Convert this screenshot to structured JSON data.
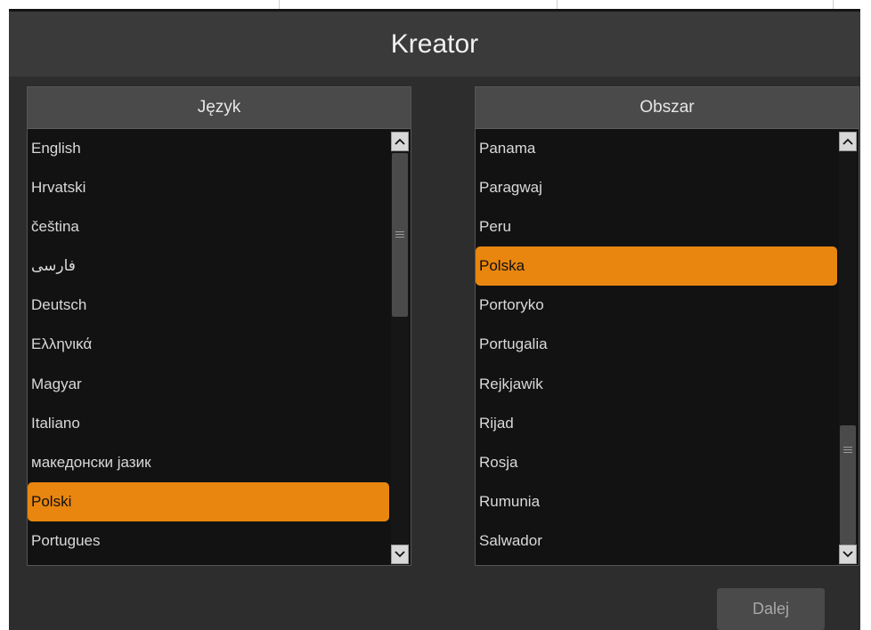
{
  "dialog": {
    "title": "Kreator",
    "next_label": "Dalej"
  },
  "language_panel": {
    "header": "Język",
    "items": [
      {
        "label": "English",
        "selected": false
      },
      {
        "label": "Hrvatski",
        "selected": false
      },
      {
        "label": "čeština",
        "selected": false
      },
      {
        "label": "فارسی",
        "selected": false
      },
      {
        "label": "Deutsch",
        "selected": false
      },
      {
        "label": "Ελληνικά",
        "selected": false
      },
      {
        "label": "Magyar",
        "selected": false
      },
      {
        "label": "Italiano",
        "selected": false
      },
      {
        "label": "македонски јазик",
        "selected": false
      },
      {
        "label": "Polski",
        "selected": true
      },
      {
        "label": "Portugues",
        "selected": false
      }
    ]
  },
  "region_panel": {
    "header": "Obszar",
    "items": [
      {
        "label": "Panama",
        "selected": false
      },
      {
        "label": "Paragwaj",
        "selected": false
      },
      {
        "label": "Peru",
        "selected": false
      },
      {
        "label": "Polska",
        "selected": true
      },
      {
        "label": "Portoryko",
        "selected": false
      },
      {
        "label": "Portugalia",
        "selected": false
      },
      {
        "label": "Rejkjawik",
        "selected": false
      },
      {
        "label": "Rijad",
        "selected": false
      },
      {
        "label": "Rosja",
        "selected": false
      },
      {
        "label": "Rumunia",
        "selected": false
      },
      {
        "label": "Salwador",
        "selected": false
      }
    ]
  },
  "colors": {
    "accent": "#e8860f",
    "background": "#2d2d2d"
  },
  "icons": {
    "scroll_up": "chevron-up-icon",
    "scroll_down": "chevron-down-icon",
    "grip": "grip-icon"
  }
}
